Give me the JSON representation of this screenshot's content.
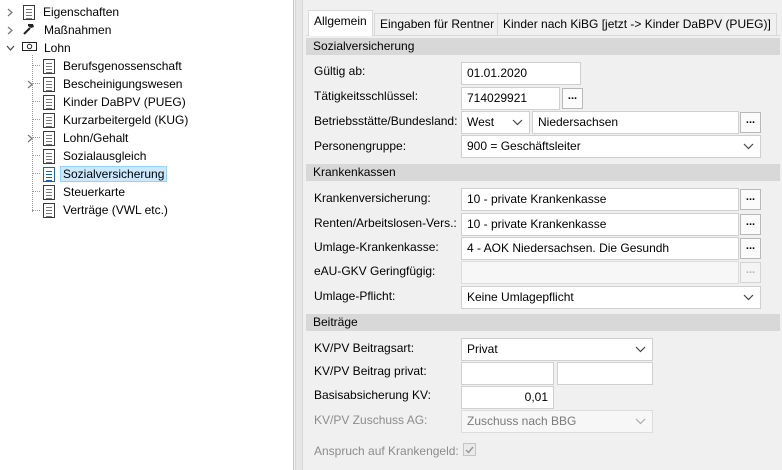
{
  "tree": {
    "items": [
      {
        "label": "Eigenschaften",
        "icon": "multi-document-icon"
      },
      {
        "label": "Maßnahmen",
        "icon": "hammer-icon"
      },
      {
        "label": "Lohn",
        "icon": "money-icon"
      },
      {
        "label": "Berufsgenossenschaft",
        "icon": "document-icon"
      },
      {
        "label": "Bescheinigungswesen",
        "icon": "multi-document-icon"
      },
      {
        "label": "Kinder DaBPV (PUEG)",
        "icon": "document-icon"
      },
      {
        "label": "Kurzarbeitergeld (KUG)",
        "icon": "document-icon"
      },
      {
        "label": "Lohn/Gehalt",
        "icon": "multi-document-icon"
      },
      {
        "label": "Sozialausgleich",
        "icon": "document-icon"
      },
      {
        "label": "Sozialversicherung",
        "icon": "document-icon"
      },
      {
        "label": "Steuerkarte",
        "icon": "document-icon"
      },
      {
        "label": "Verträge (VWL etc.)",
        "icon": "document-icon"
      }
    ]
  },
  "tabs": [
    {
      "label": "Allgemein"
    },
    {
      "label": "Eingaben für Rentner"
    },
    {
      "label": "Kinder nach KiBG [jetzt -> Kinder DaBPV (PUEG)]"
    }
  ],
  "sections": {
    "sozial": "Sozialversicherung",
    "kranken": "Krankenkassen",
    "beitraege": "Beiträge"
  },
  "fields": {
    "gueltig": {
      "label": "Gültig ab:",
      "value": "01.01.2020"
    },
    "taetigkeit": {
      "label": "Tätigkeitsschlüssel:",
      "value": "714029921"
    },
    "betrieb": {
      "label": "Betriebsstätte/Bundesland:",
      "region": "West",
      "state": "Niedersachsen"
    },
    "personen": {
      "label": "Personengruppe:",
      "value": "900 = Geschäftsleiter"
    },
    "kv": {
      "label": "Krankenversicherung:",
      "value": "10 - private Krankenkasse"
    },
    "renten": {
      "label": "Renten/Arbeitslosen-Vers.:",
      "value": "10 - private Krankenkasse"
    },
    "umlage_kk": {
      "label": "Umlage-Krankenkasse:",
      "value": "4 - AOK Niedersachsen. Die Gesundh"
    },
    "eau": {
      "label": "eAU-GKV Geringfügig:",
      "value": ""
    },
    "umlage_pflicht": {
      "label": "Umlage-Pflicht:",
      "value": "Keine Umlagepflicht"
    },
    "kvpv_art": {
      "label": "KV/PV Beitragsart:",
      "value": "Privat"
    },
    "kvpv_privat": {
      "label": "KV/PV Beitrag privat:",
      "value1": "",
      "value2": ""
    },
    "basis": {
      "label": "Basisabsicherung KV:",
      "value": "0,01"
    },
    "zuschuss": {
      "label": "KV/PV Zuschuss AG:",
      "value": "Zuschuss nach BBG"
    },
    "anspruch": {
      "label": "Anspruch auf Krankengeld:",
      "checked": true
    }
  },
  "buttons": {
    "ellipsis": "..."
  }
}
